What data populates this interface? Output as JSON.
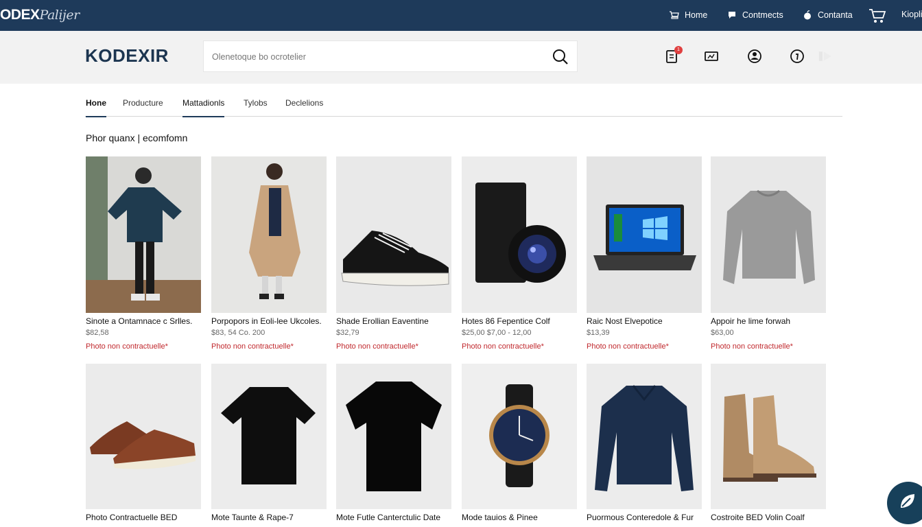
{
  "topbar": {
    "logo_bold": "ODEX",
    "logo_script": "Palijer",
    "links": [
      {
        "label": "Home",
        "icon": "cart-outline-icon"
      },
      {
        "label": "Contmects",
        "icon": "chat-icon"
      },
      {
        "label": "Contanta",
        "icon": "apple-icon"
      }
    ],
    "cart_icon": "shopping-cart-icon",
    "account_label": "Kiopli"
  },
  "header": {
    "brand": "KODEXIR",
    "search_placeholder": "Olenetoque bo ocrotelier",
    "badge_count": "1",
    "icons": [
      "clipboard-icon",
      "monitor-icon",
      "user-circle-icon",
      "info-circle-icon",
      "arrow-right-icon"
    ]
  },
  "tabs": [
    {
      "label": "Hone",
      "active": true
    },
    {
      "label": "Producture",
      "active": false
    },
    {
      "label": "Mattadionls",
      "active": false
    },
    {
      "label": "Tylobs",
      "active": false
    },
    {
      "label": "Declelions",
      "active": false
    }
  ],
  "section_title": "Phor quanx | ecomfomn",
  "products_row1": [
    {
      "name": "Sinote a Ontamnace c Srlles.",
      "price": "$82,58",
      "note": "Photo non contractuelle*",
      "image": "shirt-man-photo"
    },
    {
      "name": "Porpopors in Eoli-lee Ukcoles.",
      "price": "$83, 54 Co. 200",
      "note": "Photo non contractuelle*",
      "image": "coat-woman-photo"
    },
    {
      "name": "Shade Erollian Eaventine",
      "price": "$32,79",
      "note": "Photo non contractuelle*",
      "image": "sneaker-photo"
    },
    {
      "name": "Hotes 86 Fepentice Colf",
      "price": "$25,00 $7,00 - 12,00",
      "note": "Photo non contractuelle*",
      "image": "camera-photo"
    },
    {
      "name": "Raic Nost Elvepotice",
      "price": "$13,39",
      "note": "Photo non contractuelle*",
      "image": "laptop-photo"
    },
    {
      "name": "Appoir he lime forwah",
      "price": "$63,00",
      "note": "Photo non contractuelle*",
      "image": "sweater-photo"
    }
  ],
  "products_row2": [
    {
      "name": "Photo Contractuelle BED",
      "image": "brown-shoe-photo"
    },
    {
      "name": "Mote Taunte & Rape-7",
      "image": "black-tshirt-photo"
    },
    {
      "name": "Mote Futle Canterctulic Date",
      "image": "black-tshirt-photo"
    },
    {
      "name": "Mode tauios & Pinee",
      "image": "watch-photo"
    },
    {
      "name": "Puormous Conteredole & Fur",
      "image": "navy-sweater-photo"
    },
    {
      "name": "Costroite BED Volin Coalf",
      "image": "boots-photo"
    }
  ],
  "chat_button": {
    "icon": "leaf-chat-icon"
  },
  "colors": {
    "topbar": "#1e3a5a",
    "brand": "#1c3550",
    "note_red": "#c0282d",
    "header_bg": "#f2f2f2"
  }
}
